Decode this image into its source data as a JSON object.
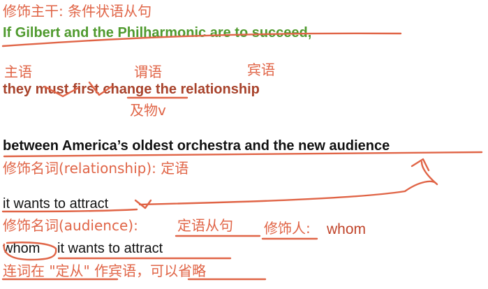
{
  "lines": {
    "heading": "修饰主干: 条件状语从句",
    "sentence_1": "If Gilbert and the Philharmonic are to succeed,",
    "label_subject": "主语",
    "label_predicate": "谓语",
    "label_object": "宾语",
    "sentence_2": "they must first change the relationship",
    "label_transitive_verb": "及物v",
    "sentence_3": "between America’s oldest orchestra and the new audience",
    "note_attributive": "修饰名词(relationship): 定语",
    "clause": "it wants to attract",
    "note_audience": "修饰名词(audience):",
    "note_relative_clause": "定语从句",
    "note_modifies_person": "修饰人:",
    "note_whom": "whom",
    "full_clause_whom": "whom",
    "full_clause_rest": "it wants to attract",
    "note_conjunction": "连词在 \"定从\" 作宾语，可以省略"
  },
  "colors": {
    "annotation": "#e06446",
    "sentence_green": "#4f9a2e",
    "sentence_brown": "#a8432c"
  }
}
